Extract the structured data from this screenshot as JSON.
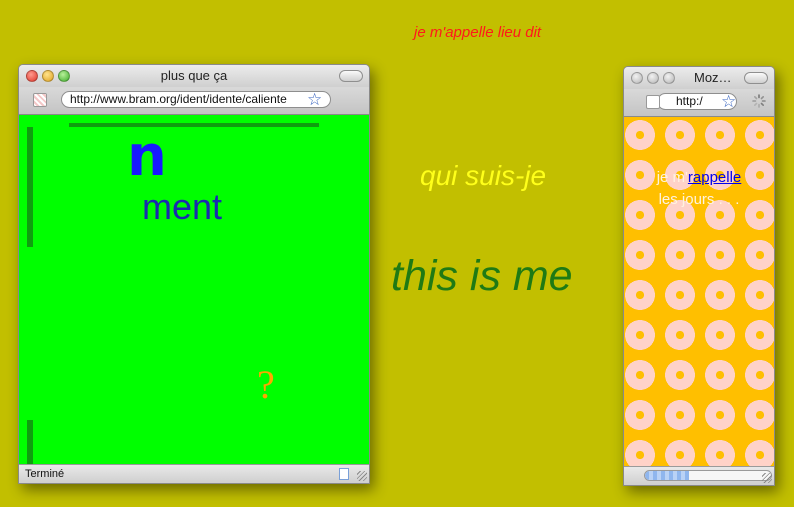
{
  "desktop": {
    "text_top": "je m'appelle lieu dit",
    "text_qui": "qui suis-je",
    "text_this": "this is me"
  },
  "window_left": {
    "title": "plus que ça",
    "url": "http://www.bram.org/ident/idente/caliente",
    "content": {
      "glyph": "n",
      "word": "ment",
      "question": "?"
    },
    "status": "Terminé"
  },
  "window_right": {
    "title": "Moz…",
    "url": "http:/",
    "content": {
      "before_link": "je m'",
      "link": "rappelle",
      "line2": "les jours . . ."
    },
    "progress": 0.35
  },
  "colors": {
    "desktop_bg": "#c2bf00",
    "left_content_bg": "#00ff00",
    "right_content_bg": "#ffbf00"
  }
}
